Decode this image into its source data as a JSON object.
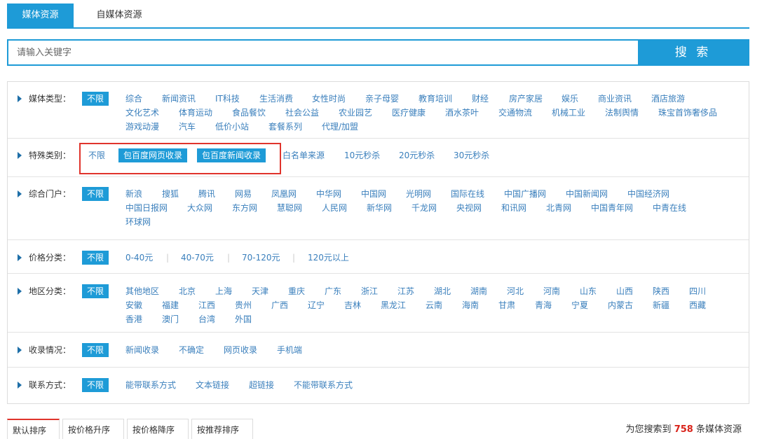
{
  "tabs": [
    "媒体资源",
    "自媒体资源"
  ],
  "search": {
    "placeholder": "请输入关键字",
    "button": "搜 索"
  },
  "filters": {
    "media_type": {
      "label": "媒体类型：",
      "items": [
        "不限",
        "综合",
        "新闻资讯",
        "IT科技",
        "生活消费",
        "女性时尚",
        "亲子母婴",
        "教育培训",
        "财经",
        "房产家居",
        "娱乐",
        "商业资讯",
        "酒店旅游",
        "文化艺术",
        "体育运动",
        "食品餐饮",
        "社会公益",
        "农业园艺",
        "医疗健康",
        "酒水茶叶",
        "交通物流",
        "机械工业",
        "法制舆情",
        "珠宝首饰奢侈品",
        "游戏动漫",
        "汽车",
        "低价小站",
        "套餐系列",
        "代理/加盟"
      ]
    },
    "special": {
      "label": "特殊类别：",
      "items": [
        "不限",
        "包百度网页收录",
        "包百度新闻收录",
        "白名单来源",
        "10元秒杀",
        "20元秒杀",
        "30元秒杀"
      ]
    },
    "portal": {
      "label": "综合门户：",
      "items": [
        "不限",
        "新浪",
        "搜狐",
        "腾讯",
        "网易",
        "凤凰网",
        "中华网",
        "中国网",
        "光明网",
        "国际在线",
        "中国广播网",
        "中国新闻网",
        "中国经济网",
        "中国日报网",
        "大众网",
        "东方网",
        "慧聪网",
        "人民网",
        "新华网",
        "千龙网",
        "央视网",
        "和讯网",
        "北青网",
        "中国青年网",
        "中青在线",
        "环球网"
      ]
    },
    "price": {
      "label": "价格分类：",
      "items": [
        "不限",
        "0-40元",
        "40-70元",
        "70-120元",
        "120元以上"
      ],
      "separator": "|"
    },
    "region": {
      "label": "地区分类：",
      "items": [
        "不限",
        "其他地区",
        "北京",
        "上海",
        "天津",
        "重庆",
        "广东",
        "浙江",
        "江苏",
        "湖北",
        "湖南",
        "河北",
        "河南",
        "山东",
        "山西",
        "陕西",
        "四川",
        "安徽",
        "福建",
        "江西",
        "贵州",
        "广西",
        "辽宁",
        "吉林",
        "黑龙江",
        "云南",
        "海南",
        "甘肃",
        "青海",
        "宁夏",
        "内蒙古",
        "新疆",
        "西藏",
        "香港",
        "澳门",
        "台湾",
        "外国"
      ]
    },
    "indexing": {
      "label": "收录情况：",
      "items": [
        "不限",
        "新闻收录",
        "不确定",
        "网页收录",
        "手机端"
      ]
    },
    "contact": {
      "label": "联系方式：",
      "items": [
        "不限",
        "能带联系方式",
        "文本链接",
        "超链接",
        "不能带联系方式"
      ]
    }
  },
  "sort": [
    "默认排序",
    "按价格升序",
    "按价格降序",
    "按推荐排序"
  ],
  "result": {
    "prefix": "为您搜索到",
    "count": "758",
    "suffix": "条媒体资源"
  },
  "colors": {
    "accent": "#1e9bd7",
    "highlight_box": "#e0342c",
    "count": "#d9231a"
  }
}
